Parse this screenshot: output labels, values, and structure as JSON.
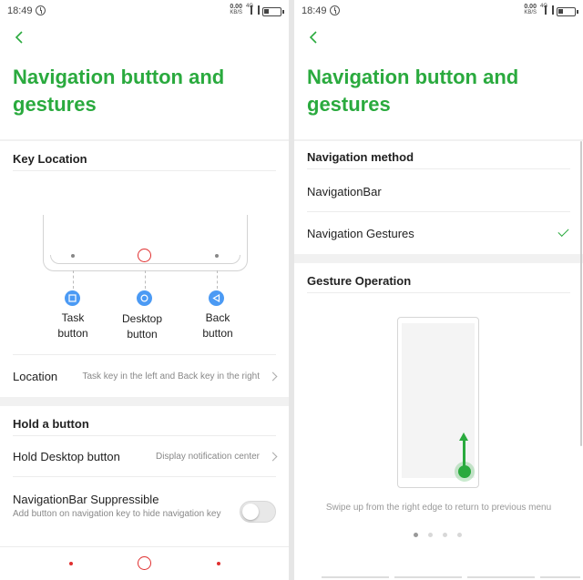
{
  "status": {
    "time": "18:49",
    "speed_value": "0.00",
    "speed_unit": "KB/S",
    "network": "4G",
    "icons": [
      "alarm-icon",
      "signal-icon",
      "battery-icon"
    ]
  },
  "colors": {
    "accent": "#2aaa3e",
    "key_blue": "#4b9af4",
    "home_red": "#e03030"
  },
  "left": {
    "title": "Navigation button and gestures",
    "key_location": {
      "heading": "Key Location",
      "keys": [
        {
          "label_line1": "Task",
          "label_line2": "button",
          "icon": "square-icon"
        },
        {
          "label_line1": "Desktop",
          "label_line2": "button",
          "icon": "circle-icon"
        },
        {
          "label_line1": "Back",
          "label_line2": "button",
          "icon": "triangle-back-icon"
        }
      ],
      "location_label": "Location",
      "location_value": "Task key in the left and Back key in the right"
    },
    "hold": {
      "heading": "Hold a button",
      "hold_desktop_label": "Hold Desktop button",
      "hold_desktop_value": "Display notification center",
      "suppress_label": "NavigationBar Suppressible",
      "suppress_desc": "Add button on navigation key to hide navigation key",
      "suppress_enabled": false
    }
  },
  "right": {
    "title": "Navigation button and gestures",
    "method_heading": "Navigation method",
    "options": [
      {
        "label": "NavigationBar",
        "selected": false
      },
      {
        "label": "Navigation Gestures",
        "selected": true
      }
    ],
    "gesture_heading": "Gesture Operation",
    "hint": "Swipe up from the right edge to return to previous menu",
    "pager": {
      "count": 4,
      "active_index": 0
    }
  }
}
